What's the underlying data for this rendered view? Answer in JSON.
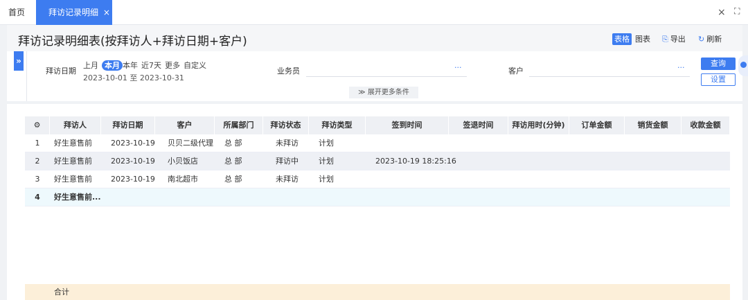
{
  "tabs": {
    "home": "首页",
    "active": "拜访记录明细",
    "active_close": "×"
  },
  "window": {
    "close": "×",
    "fullscreen": "⛶"
  },
  "header": {
    "title": "拜访记录明细表(按拜访人+拜访日期+客户)",
    "view_table": "表格",
    "view_chart": "图表",
    "export": "导出",
    "refresh": "刷新"
  },
  "filters": {
    "toggle": "»",
    "visit_date_label": "拜访日期",
    "quick_options": [
      "上月",
      "本月",
      "本年",
      "近7天",
      "更多",
      "自定义"
    ],
    "active_quick": "本月",
    "date_range": "2023-10-01 至 2023-10-31",
    "salesman_label": "业务员",
    "salesman_dots": "···",
    "customer_label": "客户",
    "customer_dots": "···",
    "query": "查询",
    "settings": "设置",
    "more_conditions": "≫ 展开更多条件"
  },
  "table": {
    "settings_icon": "⚙",
    "columns": [
      "拜访人",
      "拜访日期",
      "客户",
      "所属部门",
      "拜访状态",
      "拜访类型",
      "签到时间",
      "签退时间",
      "拜访用时(分钟)",
      "订单金额",
      "销货金额",
      "收款金额"
    ],
    "rows": [
      {
        "no": "1",
        "visitor": "好生意售前",
        "date": "2023-10-19",
        "customer": "贝贝二级代理",
        "dept": "总 部",
        "status": "未拜访",
        "type": "计划",
        "checkin": ""
      },
      {
        "no": "2",
        "visitor": "好生意售前",
        "date": "2023-10-19",
        "customer": "小贝饭店",
        "dept": "总 部",
        "status": "拜访中",
        "type": "计划",
        "checkin": "2023-10-19 18:25:16"
      },
      {
        "no": "3",
        "visitor": "好生意售前",
        "date": "2023-10-19",
        "customer": "南北超市",
        "dept": "总 部",
        "status": "未拜访",
        "type": "计划",
        "checkin": ""
      },
      {
        "no": "4",
        "visitor": "好生意售前...",
        "date": "",
        "customer": "",
        "dept": "",
        "status": "",
        "type": "",
        "checkin": ""
      }
    ],
    "total_label": "合计"
  },
  "colors": {
    "accent": "#3d7cf0",
    "total_row_bg": "#fcefd9",
    "subtotal_row_bg": "#eef9fd"
  }
}
